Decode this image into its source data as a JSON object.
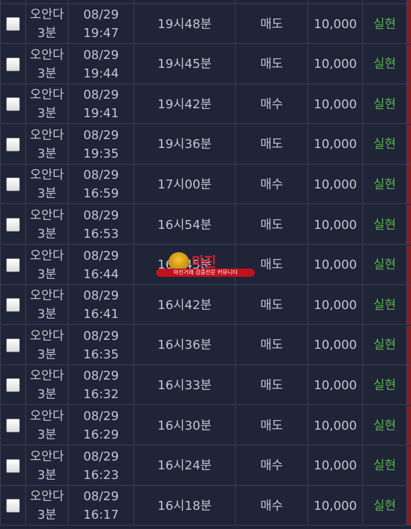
{
  "rows": [
    {
      "game_line1": "오안다",
      "game_line2": "3분",
      "date": "08/29",
      "time": "19:47",
      "round": "19시48분",
      "type": "매도",
      "amount": "10,000",
      "status": "실현"
    },
    {
      "game_line1": "오안다",
      "game_line2": "3분",
      "date": "08/29",
      "time": "19:44",
      "round": "19시45분",
      "type": "매도",
      "amount": "10,000",
      "status": "실현"
    },
    {
      "game_line1": "오안다",
      "game_line2": "3분",
      "date": "08/29",
      "time": "19:41",
      "round": "19시42분",
      "type": "매수",
      "amount": "10,000",
      "status": "실현"
    },
    {
      "game_line1": "오안다",
      "game_line2": "3분",
      "date": "08/29",
      "time": "19:35",
      "round": "19시36분",
      "type": "매도",
      "amount": "10,000",
      "status": "실현"
    },
    {
      "game_line1": "오안다",
      "game_line2": "3분",
      "date": "08/29",
      "time": "16:59",
      "round": "17시00분",
      "type": "매수",
      "amount": "10,000",
      "status": "실현"
    },
    {
      "game_line1": "오안다",
      "game_line2": "3분",
      "date": "08/29",
      "time": "16:53",
      "round": "16시54분",
      "type": "매도",
      "amount": "10,000",
      "status": "실현"
    },
    {
      "game_line1": "오안다",
      "game_line2": "3분",
      "date": "08/29",
      "time": "16:44",
      "round": "16시45분",
      "type": "매도",
      "amount": "10,000",
      "status": "실현"
    },
    {
      "game_line1": "오안다",
      "game_line2": "3분",
      "date": "08/29",
      "time": "16:41",
      "round": "16시42분",
      "type": "매도",
      "amount": "10,000",
      "status": "실현"
    },
    {
      "game_line1": "오안다",
      "game_line2": "3분",
      "date": "08/29",
      "time": "16:35",
      "round": "16시36분",
      "type": "매도",
      "amount": "10,000",
      "status": "실현"
    },
    {
      "game_line1": "오안다",
      "game_line2": "3분",
      "date": "08/29",
      "time": "16:32",
      "round": "16시33분",
      "type": "매도",
      "amount": "10,000",
      "status": "실현"
    },
    {
      "game_line1": "오안다",
      "game_line2": "3분",
      "date": "08/29",
      "time": "16:29",
      "round": "16시30분",
      "type": "매도",
      "amount": "10,000",
      "status": "실현"
    },
    {
      "game_line1": "오안다",
      "game_line2": "3분",
      "date": "08/29",
      "time": "16:23",
      "round": "16시24분",
      "type": "매수",
      "amount": "10,000",
      "status": "실현"
    },
    {
      "game_line1": "오안다",
      "game_line2": "3분",
      "date": "08/29",
      "time": "16:17",
      "round": "16시18분",
      "type": "매수",
      "amount": "10,000",
      "status": "실현"
    }
  ],
  "watermark": {
    "title": "마진",
    "tagline": "마진거래 검증전문 커뮤니티"
  },
  "colors": {
    "background": "#1f2437",
    "status_green": "#5ab24a",
    "watermark_red": "#e11d2b"
  }
}
